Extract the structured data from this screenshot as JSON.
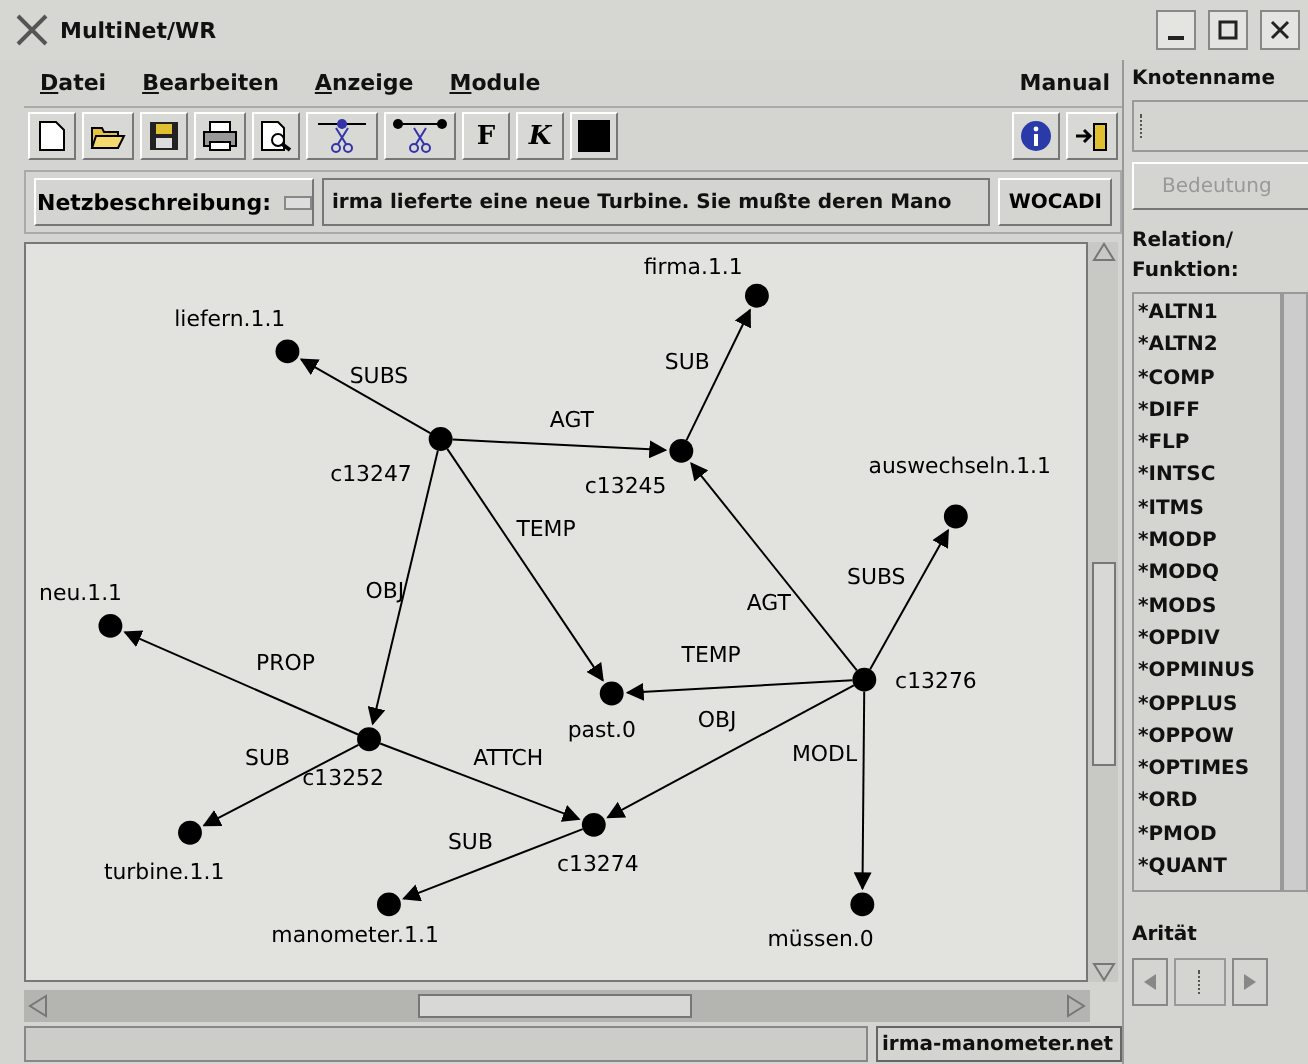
{
  "window": {
    "title": "MultiNet/WR"
  },
  "menu": [
    {
      "label": "Datei"
    },
    {
      "label": "Bearbeiten"
    },
    {
      "label": "Anzeige"
    },
    {
      "label": "Module"
    }
  ],
  "manual": "Manual",
  "toolbar": {
    "bold": "F",
    "italic": "K"
  },
  "description": {
    "label": "Netzbeschreibung:",
    "value": "irma lieferte eine neue Turbine. Sie mußte deren Mano",
    "button": "WOCADI"
  },
  "graph": {
    "nodes": [
      {
        "label": "liefern.1.1"
      },
      {
        "label": "firma.1.1"
      },
      {
        "label": "c13247"
      },
      {
        "label": "c13245"
      },
      {
        "label": "auswechseln.1.1"
      },
      {
        "label": "neu.1.1"
      },
      {
        "label": "past.0"
      },
      {
        "label": "c13276"
      },
      {
        "label": "c13252"
      },
      {
        "label": "c13274"
      },
      {
        "label": "turbine.1.1"
      },
      {
        "label": "manometer.1.1"
      },
      {
        "label": "müssen.0"
      }
    ],
    "edges": [
      {
        "label": "SUBS"
      },
      {
        "label": "SUB"
      },
      {
        "label": "AGT"
      },
      {
        "label": "TEMP"
      },
      {
        "label": "OBJ"
      },
      {
        "label": "AGT"
      },
      {
        "label": "SUBS"
      },
      {
        "label": "TEMP"
      },
      {
        "label": "OBJ"
      },
      {
        "label": "MODL"
      },
      {
        "label": "PROP"
      },
      {
        "label": "SUB"
      },
      {
        "label": "ATTCH"
      },
      {
        "label": "SUB"
      }
    ]
  },
  "status": {
    "file": "irma-manometer.net"
  },
  "side": {
    "node_label": "Knotenname",
    "meaning_button": {
      "label": "Bedeutung",
      "disabled": true
    },
    "relation_label": "Relation/",
    "function_label": "Funktion:",
    "relations": [
      "*ALTN1",
      "*ALTN2",
      "*COMP",
      "*DIFF",
      "*FLP",
      "*INTSC",
      "*ITMS",
      "*MODP",
      "*MODQ",
      "*MODS",
      "*OPDIV",
      "*OPMINUS",
      "*OPPLUS",
      "*OPPOW",
      "*OPTIMES",
      "*ORD",
      "*PMOD",
      "*QUANT"
    ],
    "arity_label": "Arität"
  }
}
